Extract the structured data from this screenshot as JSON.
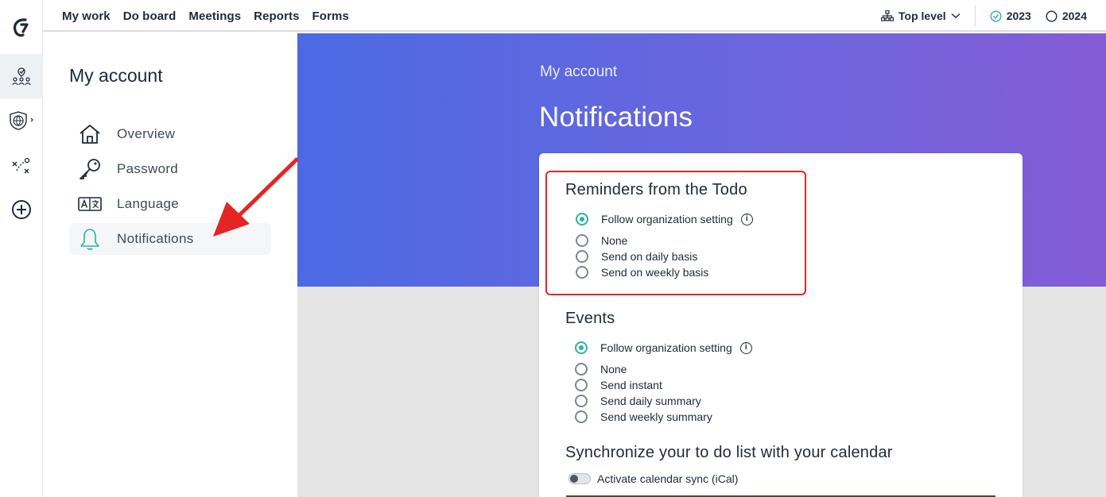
{
  "topnav": {
    "menu": [
      "My work",
      "Do board",
      "Meetings",
      "Reports",
      "Forms"
    ],
    "level_label": "Top level",
    "year_current": "2023",
    "year_next": "2024"
  },
  "rail": {
    "icons": [
      "logo-icon",
      "people-icon",
      "globe-shield-icon",
      "strategy-icon",
      "add-icon"
    ]
  },
  "sidebar": {
    "title": "My account",
    "items": [
      {
        "label": "Overview",
        "icon": "home-icon"
      },
      {
        "label": "Password",
        "icon": "key-icon"
      },
      {
        "label": "Language",
        "icon": "language-icon"
      },
      {
        "label": "Notifications",
        "icon": "bell-icon",
        "active": true
      }
    ]
  },
  "hero": {
    "breadcrumb": "My account",
    "title": "Notifications"
  },
  "reminders": {
    "title": "Reminders from the Todo",
    "options": [
      "Follow organization setting",
      "None",
      "Send on daily basis",
      "Send on weekly basis"
    ],
    "selected": 0
  },
  "events": {
    "title": "Events",
    "options": [
      "Follow organization setting",
      "None",
      "Send instant",
      "Send daily summary",
      "Send weekly summary"
    ],
    "selected": 0
  },
  "calendar": {
    "title": "Synchronize your to do list with your calendar",
    "toggle_label": "Activate calendar sync (iCal)"
  },
  "colors": {
    "accent": "#2bb3a0",
    "hero_start": "#4b6ae4",
    "hero_end": "#845cd6",
    "annotation": "#e52424"
  }
}
